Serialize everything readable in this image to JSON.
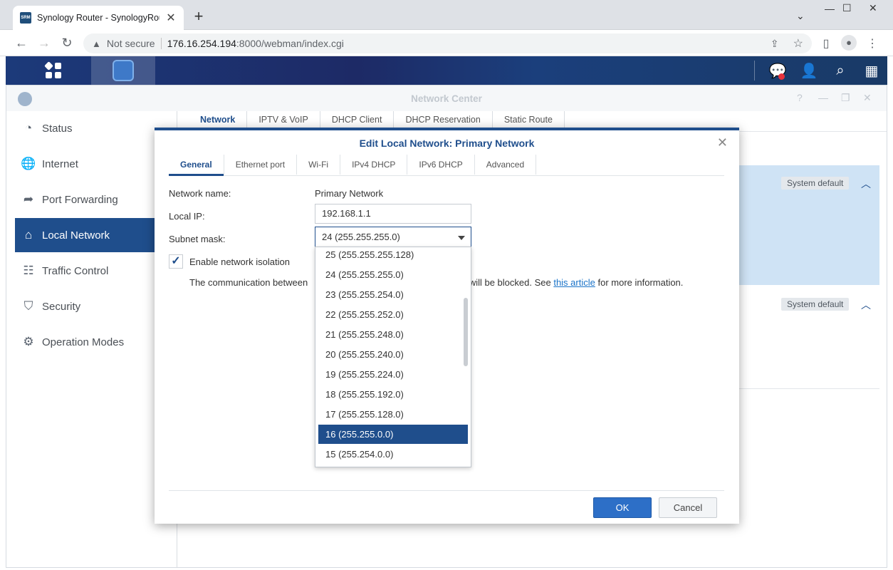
{
  "browser": {
    "tab_title": "Synology Router - SynologyRoute",
    "favicon_text": "SRM",
    "security_label": "Not secure",
    "url_host": "176.16.254.194",
    "url_rest": ":8000/webman/index.cgi"
  },
  "window": {
    "title": "Network Center"
  },
  "sidebar": {
    "items": [
      {
        "label": "Status",
        "icon": "gauge-icon"
      },
      {
        "label": "Internet",
        "icon": "globe-icon"
      },
      {
        "label": "Port Forwarding",
        "icon": "share-arrow-icon"
      },
      {
        "label": "Local Network",
        "icon": "home-network-icon"
      },
      {
        "label": "Traffic Control",
        "icon": "sliders-icon"
      },
      {
        "label": "Security",
        "icon": "shield-icon"
      },
      {
        "label": "Operation Modes",
        "icon": "router-icon"
      }
    ],
    "active_index": 3
  },
  "nc_tabs": [
    "Network",
    "IPTV & VoIP",
    "DHCP Client",
    "DHCP Reservation",
    "Static Route"
  ],
  "background": {
    "badge1": "System default",
    "badge2": "System default"
  },
  "dialog": {
    "title": "Edit Local Network: Primary Network",
    "tabs": [
      "General",
      "Ethernet port",
      "Wi-Fi",
      "IPv4 DHCP",
      "IPv6 DHCP",
      "Advanced"
    ],
    "fields": {
      "network_name_label": "Network name:",
      "network_name_value": "Primary Network",
      "local_ip_label": "Local IP:",
      "local_ip_value": "192.168.1.1",
      "subnet_label": "Subnet mask:",
      "subnet_value": "24 (255.255.255.0)"
    },
    "isolation_label": "Enable network isolation",
    "isolation_checked": true,
    "note_start": "The communication between",
    "note_mid": "ks will be blocked. See ",
    "note_link": "this article",
    "note_end": " for more information.",
    "ok_label": "OK",
    "cancel_label": "Cancel"
  },
  "dropdown": {
    "options": [
      "25 (255.255.255.128)",
      "24 (255.255.255.0)",
      "23 (255.255.254.0)",
      "22 (255.255.252.0)",
      "21 (255.255.248.0)",
      "20 (255.255.240.0)",
      "19 (255.255.224.0)",
      "18 (255.255.192.0)",
      "17 (255.255.128.0)",
      "16 (255.255.0.0)",
      "15 (255.254.0.0)"
    ],
    "highlighted": "16 (255.255.0.0)"
  },
  "colors": {
    "accent": "#1f4e8c",
    "ok_button": "#2d6fc7",
    "link": "#1a73c8"
  }
}
